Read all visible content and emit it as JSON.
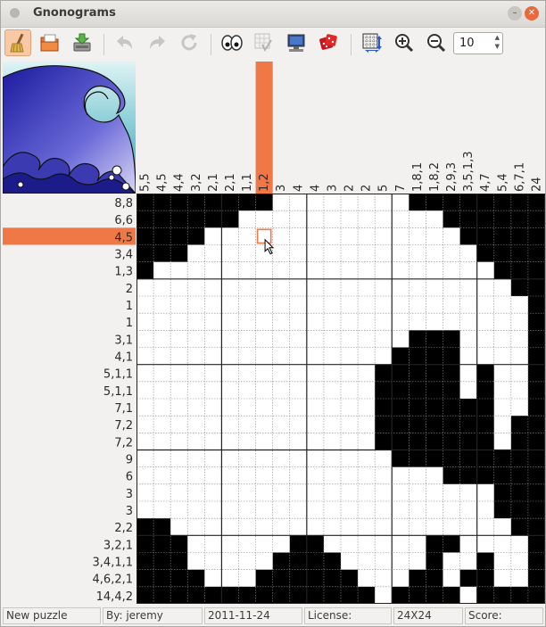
{
  "window": {
    "title": "Gnonograms"
  },
  "toolbar": {
    "zoom_value": "10",
    "buttons": [
      {
        "name": "new-puzzle-icon",
        "active": true
      },
      {
        "name": "open-icon"
      },
      {
        "name": "save-icon"
      },
      {
        "name": "undo-icon",
        "disabled": true
      },
      {
        "name": "redo-icon",
        "disabled": true
      },
      {
        "name": "restart-icon",
        "disabled": true
      },
      {
        "name": "peek-eyes-icon"
      },
      {
        "name": "check-errors-icon",
        "disabled": true
      },
      {
        "name": "computer-solve-icon"
      },
      {
        "name": "random-dice-icon"
      },
      {
        "name": "resize-grid-icon"
      },
      {
        "name": "zoom-in-icon"
      },
      {
        "name": "zoom-out-icon"
      }
    ]
  },
  "puzzle": {
    "size": 24,
    "highlight_row": 2,
    "highlight_col": 7,
    "cursor_cell": {
      "row": 2,
      "col": 7
    },
    "highlight_color": "#f07746",
    "row_clues": [
      "8,8",
      "6,6",
      "4,5",
      "3,4",
      "1,3",
      "2",
      "1",
      "1",
      "3,1",
      "4,1",
      "5,1,1",
      "5,1,1",
      "7,1",
      "7,2",
      "7,2",
      "9",
      "6",
      "3",
      "3",
      "2,2",
      "3,2,1",
      "3,4,1,1",
      "4,6,2,1",
      "14,4,2"
    ],
    "col_clues": [
      "5,5",
      "4,5",
      "4,4",
      "3,2",
      "2,1",
      "2,1",
      "1,1",
      "1,2",
      "3",
      "4",
      "4",
      "3",
      "2",
      "2",
      "5",
      "7",
      "1,8,1",
      "1,8,2",
      "2,9,3",
      "3,5,1,3",
      "4,7",
      "5,4",
      "6,7,1",
      "24"
    ],
    "filled": [
      [
        0,
        1,
        2,
        3,
        4,
        5,
        6,
        7,
        16,
        17,
        18,
        19,
        20,
        21,
        22,
        23
      ],
      [
        0,
        1,
        2,
        3,
        4,
        5,
        18,
        19,
        20,
        21,
        22,
        23
      ],
      [
        0,
        1,
        2,
        3,
        19,
        20,
        21,
        22,
        23
      ],
      [
        0,
        1,
        2,
        20,
        21,
        22,
        23
      ],
      [
        0,
        21,
        22,
        23
      ],
      [
        22,
        23
      ],
      [
        23
      ],
      [
        23
      ],
      [
        16,
        17,
        18,
        23
      ],
      [
        15,
        16,
        17,
        18,
        23
      ],
      [
        14,
        15,
        16,
        17,
        18,
        20,
        23
      ],
      [
        14,
        15,
        16,
        17,
        18,
        20,
        23
      ],
      [
        14,
        15,
        16,
        17,
        18,
        19,
        20,
        23
      ],
      [
        14,
        15,
        16,
        17,
        18,
        19,
        20,
        22,
        23
      ],
      [
        14,
        15,
        16,
        17,
        18,
        19,
        20,
        22,
        23
      ],
      [
        15,
        16,
        17,
        18,
        19,
        20,
        21,
        22,
        23
      ],
      [
        18,
        19,
        20,
        21,
        22,
        23
      ],
      [
        21,
        22,
        23
      ],
      [
        21,
        22,
        23
      ],
      [
        0,
        1,
        22,
        23
      ],
      [
        0,
        1,
        2,
        9,
        10,
        17,
        18,
        23
      ],
      [
        0,
        1,
        2,
        8,
        9,
        10,
        11,
        17,
        20,
        23
      ],
      [
        0,
        1,
        2,
        3,
        7,
        8,
        9,
        10,
        11,
        12,
        16,
        17,
        19,
        20,
        23
      ],
      [
        0,
        1,
        2,
        3,
        4,
        5,
        6,
        7,
        8,
        9,
        10,
        11,
        12,
        13,
        15,
        16,
        17,
        18,
        20,
        21,
        22,
        23
      ]
    ]
  },
  "status": {
    "name": "New puzzle",
    "author": "By: jeremy",
    "date": "2011-11-24",
    "license": "License:",
    "dimensions": "24X24",
    "score": "Score:"
  }
}
